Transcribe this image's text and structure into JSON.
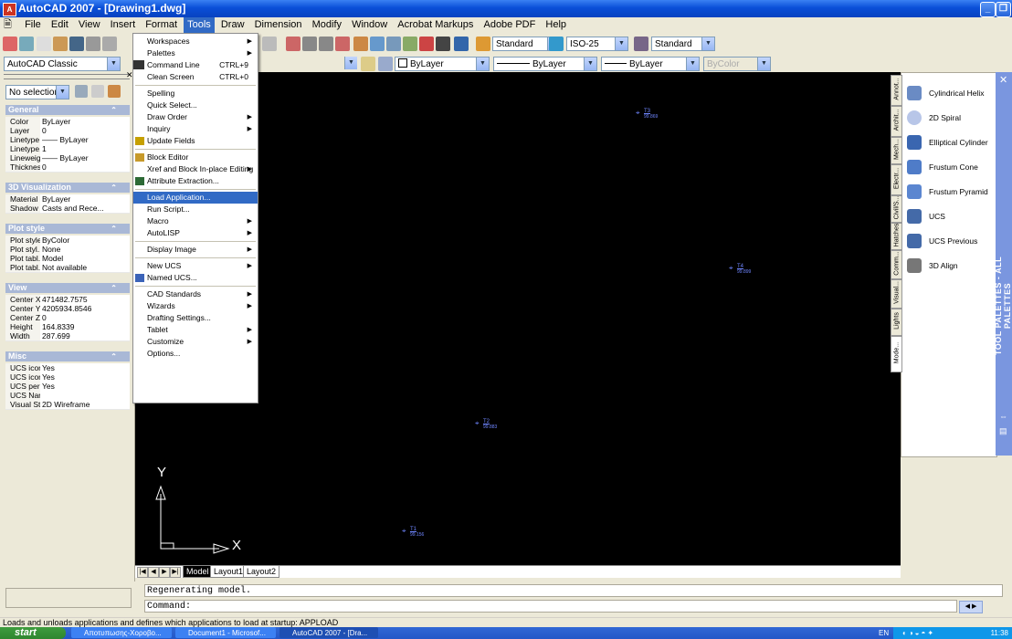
{
  "window": {
    "title": "AutoCAD 2007 - [Drawing1.dwg]"
  },
  "menubar": [
    "File",
    "Edit",
    "View",
    "Insert",
    "Format",
    "Tools",
    "Draw",
    "Dimension",
    "Modify",
    "Window",
    "Acrobat Markups",
    "Adobe PDF",
    "Help"
  ],
  "toolbar": {
    "textstyle": "Standard",
    "dimstyle": "ISO-25",
    "tablestyle": "Standard",
    "workspace": "AutoCAD Classic",
    "layer_color": "ByLayer",
    "linetype": "ByLayer",
    "lineweight": "ByLayer",
    "plotstyle": "ByColor"
  },
  "properties": {
    "selection": "No selection",
    "sections": [
      {
        "title": "General",
        "rows": [
          [
            "Color",
            "ByLayer"
          ],
          [
            "Layer",
            "0"
          ],
          [
            "Linetype",
            "—— ByLayer"
          ],
          [
            "Linetype...",
            "1"
          ],
          [
            "Lineweight",
            "—— ByLayer"
          ],
          [
            "Thickness",
            "0"
          ]
        ]
      },
      {
        "title": "3D Visualization",
        "rows": [
          [
            "Material",
            "ByLayer"
          ],
          [
            "Shadow ...",
            "Casts and Rece..."
          ]
        ]
      },
      {
        "title": "Plot style",
        "rows": [
          [
            "Plot style",
            "ByColor"
          ],
          [
            "Plot styl...",
            "None"
          ],
          [
            "Plot tabl...",
            "Model"
          ],
          [
            "Plot tabl...",
            "Not available"
          ]
        ]
      },
      {
        "title": "View",
        "rows": [
          [
            "Center X",
            "471482.7575"
          ],
          [
            "Center Y",
            "4205934.8546"
          ],
          [
            "Center Z",
            "0"
          ],
          [
            "Height",
            "164.8339"
          ],
          [
            "Width",
            "287.699"
          ]
        ]
      },
      {
        "title": "Misc",
        "rows": [
          [
            "UCS icon...",
            "Yes"
          ],
          [
            "UCS icon...",
            "Yes"
          ],
          [
            "UCS per ...",
            "Yes"
          ],
          [
            "UCS Name",
            ""
          ],
          [
            "Visual Style",
            "2D Wireframe"
          ]
        ]
      }
    ]
  },
  "tools_menu": [
    {
      "label": "Workspaces",
      "submenu": true
    },
    {
      "label": "Palettes",
      "submenu": true
    },
    {
      "label": "Command Line",
      "shortcut": "CTRL+9"
    },
    {
      "label": "Clean Screen",
      "shortcut": "CTRL+0"
    },
    {
      "sep": true
    },
    {
      "label": "Spelling"
    },
    {
      "label": "Quick Select..."
    },
    {
      "label": "Draw Order",
      "submenu": true
    },
    {
      "label": "Inquiry",
      "submenu": true
    },
    {
      "label": "Update Fields"
    },
    {
      "sep": true
    },
    {
      "label": "Block Editor"
    },
    {
      "label": "Xref and Block In-place Editing",
      "submenu": true
    },
    {
      "label": "Attribute Extraction..."
    },
    {
      "sep": true
    },
    {
      "label": "Load Application...",
      "highlight": true
    },
    {
      "label": "Run Script..."
    },
    {
      "label": "Macro",
      "submenu": true
    },
    {
      "label": "AutoLISP",
      "submenu": true
    },
    {
      "sep": true
    },
    {
      "label": "Display Image",
      "submenu": true
    },
    {
      "sep": true
    },
    {
      "label": "New UCS",
      "submenu": true
    },
    {
      "label": "Named UCS..."
    },
    {
      "sep": true
    },
    {
      "label": "CAD Standards",
      "submenu": true
    },
    {
      "label": "Wizards",
      "submenu": true
    },
    {
      "label": "Drafting Settings..."
    },
    {
      "label": "Tablet",
      "submenu": true
    },
    {
      "label": "Customize",
      "submenu": true
    },
    {
      "label": "Options..."
    }
  ],
  "points": [
    {
      "name": "T3",
      "value": "99.869"
    },
    {
      "name": "T4",
      "value": "99.899"
    },
    {
      "name": "T2",
      "value": "99.883"
    },
    {
      "name": "T1",
      "value": "99.156"
    }
  ],
  "ucs": {
    "y": "Y",
    "x": "X"
  },
  "layout_tabs": [
    "Model",
    "Layout1",
    "Layout2"
  ],
  "command": {
    "history": "Regenerating model.",
    "prompt": "Command:"
  },
  "status_text": "Loads and unloads applications and defines which applications to load at startup:  APPLOAD",
  "palette": {
    "title": "TOOL PALETTES - ALL PALETTES",
    "tabs": [
      "Annot...",
      "Archit...",
      "Mech...",
      "Electr...",
      "Civil/S...",
      "Hatches",
      "Comm...",
      "Visual...",
      "Lights",
      "Mode..."
    ],
    "items": [
      "Cylindrical Helix",
      "2D Spiral",
      "Elliptical Cylinder",
      "Frustum Cone",
      "Frustum Pyramid",
      "UCS",
      "UCS Previous",
      "3D Align"
    ]
  },
  "taskbar": {
    "start": "start",
    "tasks": [
      "Αποτυπωσης-Χοροβο...",
      "Document1 - Microsof...",
      "AutoCAD 2007 - [Dra..."
    ],
    "lang": "EN",
    "clock": "11:38"
  },
  "colors": {
    "canvas": "#000000",
    "highlight": "#316ac5",
    "point_marker": "#6f86ff",
    "title_bar": "#0a4fd8"
  }
}
